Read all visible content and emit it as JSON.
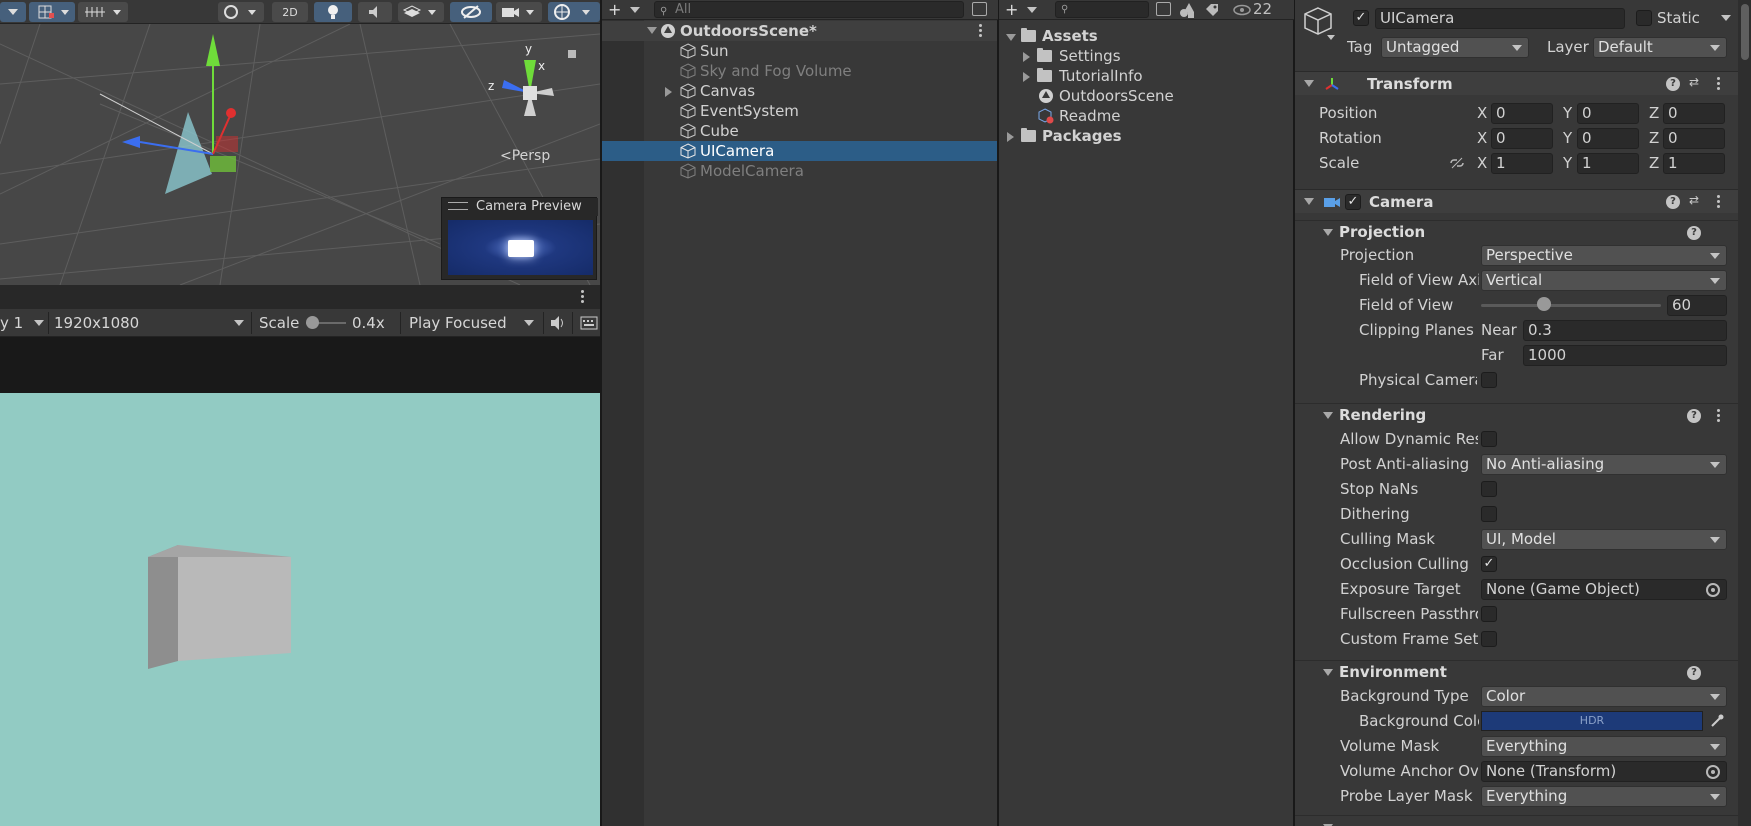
{
  "scene": {
    "toolbar": {
      "mode_2d": "2D"
    },
    "gizmo_labels": {
      "x": "x",
      "y": "y",
      "z": "z"
    },
    "persp_label": "Persp",
    "camera_preview_title": "Camera Preview"
  },
  "game": {
    "display": "y 1",
    "resolution": "1920x1080",
    "scale_label": "Scale",
    "scale_value": "0.4x",
    "play_mode": "Play Focused"
  },
  "hierarchy": {
    "search_placeholder": "All",
    "scene_name": "OutdoorsScene*",
    "items": [
      {
        "label": "Sun"
      },
      {
        "label": "Sky and Fog Volume"
      },
      {
        "label": "Canvas"
      },
      {
        "label": "EventSystem"
      },
      {
        "label": "Cube"
      },
      {
        "label": "UICamera"
      },
      {
        "label": "ModelCamera"
      }
    ]
  },
  "project": {
    "hidden_count": "22",
    "items": [
      {
        "label": "Assets"
      },
      {
        "label": "Settings"
      },
      {
        "label": "TutorialInfo"
      },
      {
        "label": "OutdoorsScene"
      },
      {
        "label": "Readme"
      },
      {
        "label": "Packages"
      }
    ]
  },
  "inspector": {
    "object_name": "UICamera",
    "static_label": "Static",
    "tag_label": "Tag",
    "tag_value": "Untagged",
    "layer_label": "Layer",
    "layer_value": "Default",
    "transform": {
      "title": "Transform",
      "position_label": "Position",
      "rotation_label": "Rotation",
      "scale_label": "Scale",
      "axis_x": "X",
      "axis_y": "Y",
      "axis_z": "Z",
      "position": [
        "0",
        "0",
        "0"
      ],
      "rotation": [
        "0",
        "0",
        "0"
      ],
      "scale": [
        "1",
        "1",
        "1"
      ]
    },
    "camera": {
      "title": "Camera",
      "projection_section": "Projection",
      "projection_label": "Projection",
      "projection_value": "Perspective",
      "fov_axis_label": "Field of View Axi",
      "fov_axis_value": "Vertical",
      "fov_label": "Field of View",
      "fov_value": "60",
      "fov_fraction": 0.35,
      "clipping_label": "Clipping Planes",
      "near_label": "Near",
      "near_value": "0.3",
      "far_label": "Far",
      "far_value": "1000",
      "physical_label": "Physical Camera",
      "rendering_section": "Rendering",
      "dynamic_res_label": "Allow Dynamic Res",
      "post_aa_label": "Post Anti-aliasing",
      "post_aa_value": "No Anti-aliasing",
      "stop_nans_label": "Stop NaNs",
      "dithering_label": "Dithering",
      "culling_mask_label": "Culling Mask",
      "culling_mask_value": "UI, Model",
      "occlusion_label": "Occlusion Culling",
      "exposure_label": "Exposure Target",
      "exposure_value": "None (Game Object)",
      "fullscreen_label": "Fullscreen Passthro",
      "custom_frame_label": "Custom Frame Sett",
      "environment_section": "Environment",
      "bg_type_label": "Background Type",
      "bg_type_value": "Color",
      "bg_color_label": "Background Colo",
      "bg_color_hdr": "HDR",
      "bg_color": "#1d3a78",
      "volume_mask_label": "Volume Mask",
      "volume_mask_value": "Everything",
      "volume_anchor_label": "Volume Anchor Ove",
      "volume_anchor_value": "None (Transform)",
      "probe_mask_label": "Probe Layer Mask",
      "probe_mask_value": "Everything"
    }
  },
  "colors": {
    "selection": "#2c5d87",
    "game_background": "#92cbc3",
    "accent_active": "#46607c"
  }
}
